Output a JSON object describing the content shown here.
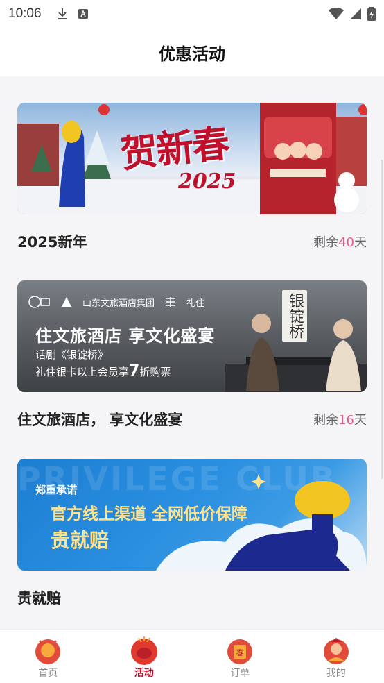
{
  "status_bar": {
    "time": "10:06"
  },
  "header": {
    "title": "优惠活动"
  },
  "activities": [
    {
      "title": "2025新年",
      "remaining_prefix": "剩余",
      "remaining_count": "40",
      "remaining_unit": "天",
      "banner": {
        "headline": "贺新春",
        "year": "2025"
      }
    },
    {
      "title": "住文旅酒店， 享文化盛宴",
      "remaining_prefix": "剩余",
      "remaining_count": "16",
      "remaining_unit": "天",
      "banner": {
        "logo_group": "山东文旅酒店集团",
        "logo_club": "礼住",
        "headline": "住文旅酒店 享文化盛宴",
        "line1": "话剧《银锭桥》",
        "line2_pre": "礼住银卡以上会员享",
        "line2_num": "7",
        "line2_post": "折购票",
        "side_title": "银锭桥"
      }
    },
    {
      "title": "贵就赔",
      "banner": {
        "bg_text": "PRIVILEGE CLUB",
        "promise": "郑重承诺",
        "headline": "官方线上渠道 全网低价保障",
        "big": "贵就赔"
      }
    }
  ],
  "tabbar": {
    "items": [
      {
        "label": "首页",
        "active": false,
        "icon": "home-icon"
      },
      {
        "label": "活动",
        "active": true,
        "icon": "activity-icon"
      },
      {
        "label": "订单",
        "active": false,
        "icon": "order-icon"
      },
      {
        "label": "我的",
        "active": false,
        "icon": "profile-icon"
      }
    ]
  },
  "colors": {
    "accent": "#c0102b",
    "remaining_num": "#e85a86"
  }
}
